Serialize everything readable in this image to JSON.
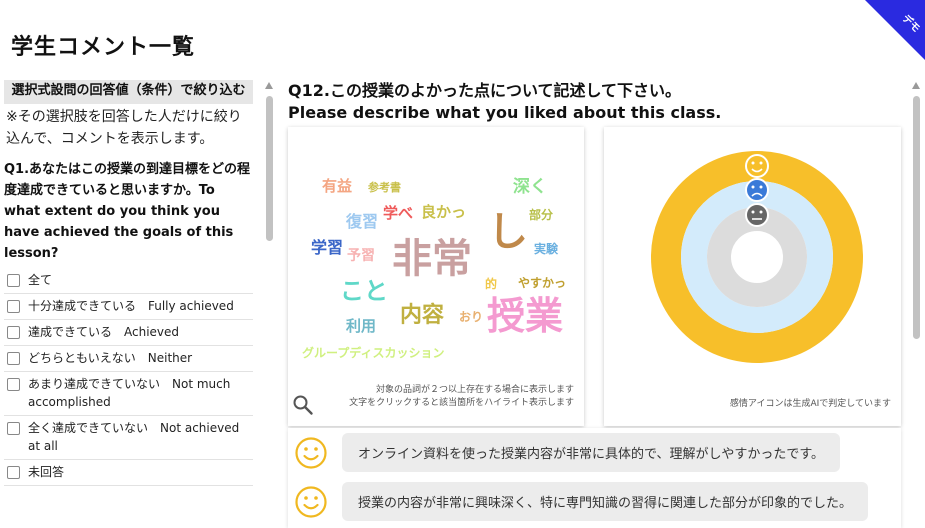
{
  "page": {
    "title": "学生コメント一覧",
    "ribbon_label": "デモ"
  },
  "filter": {
    "header": "選択式設問の回答値（条件）で絞り込む",
    "note": "※その選択肢を回答した人だけに絞り込んで、コメントを表示します。",
    "question": "Q1.あなたはこの授業の到達目標をどの程度達成できていると思いますか。To what extent do you think you have achieved the goals of this lesson?",
    "options": [
      "全て",
      "十分達成できている　Fully achieved",
      "達成できている　Achieved",
      "どちらともいえない　Neither",
      "あまり達成できていない　Not much accomplished",
      "全く達成できていない　Not achieved at all",
      "未回答"
    ]
  },
  "main": {
    "question_ja": "Q12.この授業のよかった点について記述して下さい。",
    "question_en": "Please describe what you liked about this class.",
    "wordcloud": {
      "words": [
        {
          "text": "有益",
          "color": "#f4a582"
        },
        {
          "text": "参考書",
          "color": "#c9c04a"
        },
        {
          "text": "深く",
          "color": "#8fe38f"
        },
        {
          "text": "復習",
          "color": "#9ec9f0"
        },
        {
          "text": "学べ",
          "color": "#ef5a5a"
        },
        {
          "text": "良かっ",
          "color": "#c9c04a"
        },
        {
          "text": "部分",
          "color": "#b8c04a"
        },
        {
          "text": "し",
          "color": "#c0894a"
        },
        {
          "text": "学習",
          "color": "#3a66c8"
        },
        {
          "text": "予習",
          "color": "#f7b2b2"
        },
        {
          "text": "非常",
          "color": "#c9a0a0"
        },
        {
          "text": "実験",
          "color": "#6ab0e0"
        },
        {
          "text": "こと",
          "color": "#5fd8c8"
        },
        {
          "text": "的",
          "color": "#f0c84a"
        },
        {
          "text": "やすかっ",
          "color": "#c0a030"
        },
        {
          "text": "利用",
          "color": "#6fb8c8"
        },
        {
          "text": "内容",
          "color": "#c0b040"
        },
        {
          "text": "おり",
          "color": "#e8b070"
        },
        {
          "text": "授業",
          "color": "#f49ad0"
        },
        {
          "text": "グループディスカッション",
          "color": "#d0f080"
        }
      ],
      "footnote_1": "対象の品詞が２つ以上存在する場合に表示します",
      "footnote_2": "文字をクリックすると該当箇所をハイライト表示します"
    },
    "sentiment": {
      "icons": [
        "positive-face",
        "negative-face",
        "neutral-face"
      ],
      "ring_colors": {
        "positive": "#f7bf2a",
        "negative": "#d3ebfb",
        "neutral": "#dcdcdc"
      },
      "footnote": "感情アイコンは生成AIで判定しています"
    },
    "comments": [
      {
        "sentiment": "positive",
        "text": "オンライン資料を使った授業内容が非常に具体的で、理解がしやすかったです。"
      },
      {
        "sentiment": "positive",
        "text": "授業の内容が非常に興味深く、特に専門知識の習得に関連した部分が印象的でした。"
      }
    ]
  }
}
